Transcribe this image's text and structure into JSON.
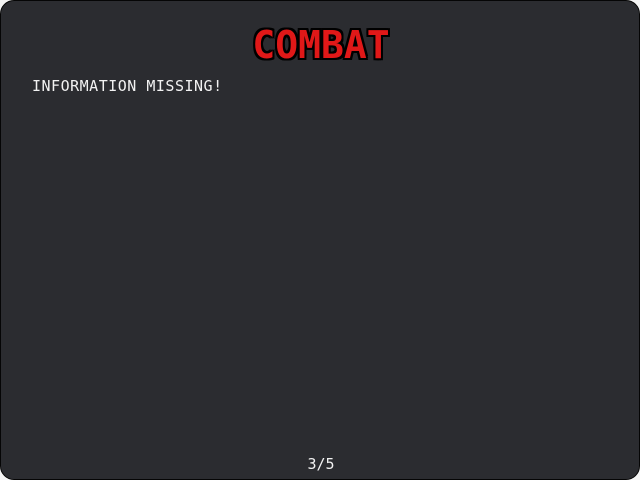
{
  "panel": {
    "title": "COMBAT",
    "message": "INFORMATION MISSING!",
    "page_indicator": "3/5"
  },
  "colors": {
    "background": "#2b2c30",
    "title": "#e01818",
    "text": "#f2f2f2"
  }
}
